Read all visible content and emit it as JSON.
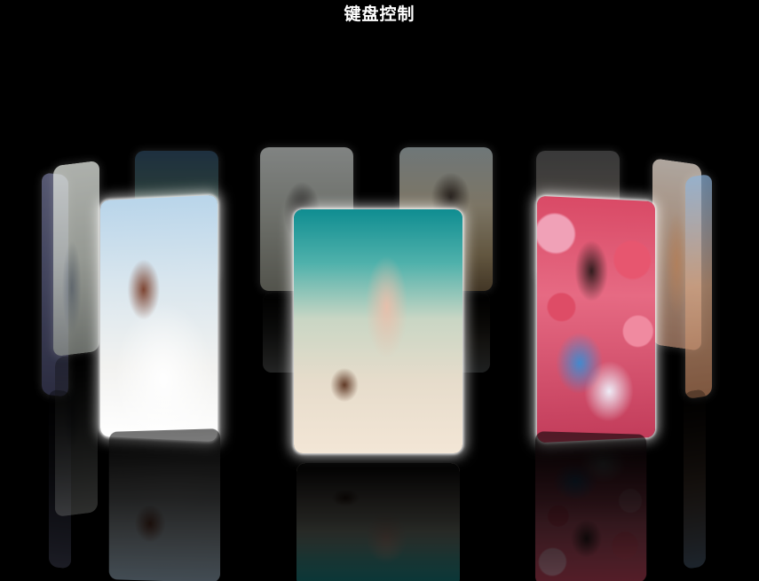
{
  "page": {
    "title": "键盘控制"
  },
  "carousel": {
    "cards": [
      {
        "name": "far-left-lavender"
      },
      {
        "name": "left-arch"
      },
      {
        "name": "back-forest"
      },
      {
        "name": "back-hat"
      },
      {
        "name": "back-beach"
      },
      {
        "name": "back-girl"
      },
      {
        "name": "right-sunset"
      },
      {
        "name": "far-right-blue"
      },
      {
        "name": "front-left-wedding"
      },
      {
        "name": "front-center-underwater"
      },
      {
        "name": "front-right-roses"
      }
    ]
  }
}
